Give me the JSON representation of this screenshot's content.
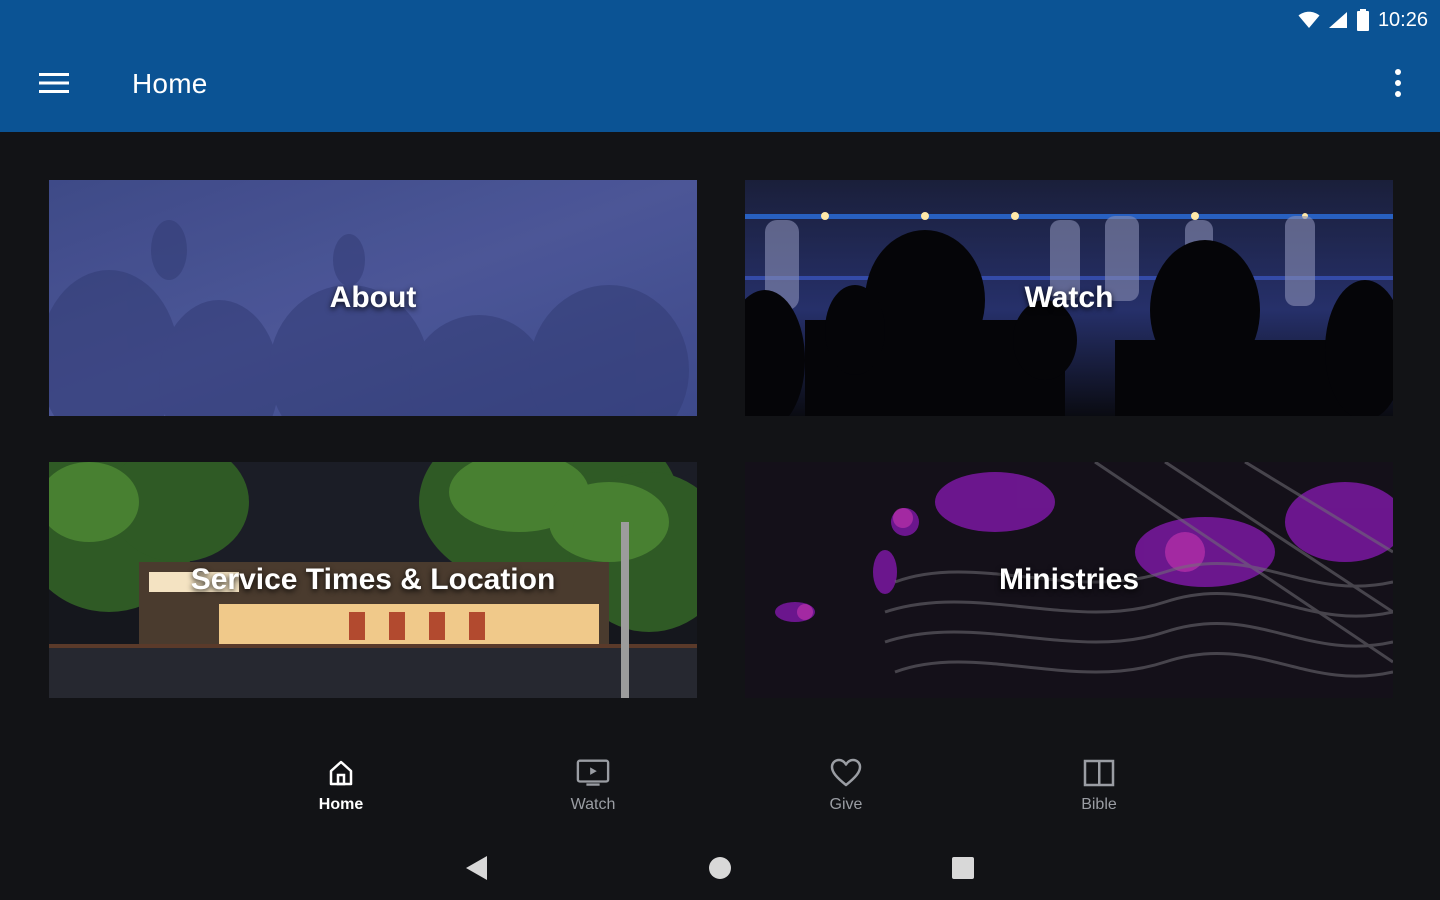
{
  "status_bar": {
    "time": "10:26",
    "icons": [
      "wifi-icon",
      "cell-signal-icon",
      "battery-icon"
    ]
  },
  "app_bar": {
    "title": "Home",
    "menu_icon": "hamburger-menu-icon",
    "overflow_icon": "more-vert-icon",
    "color": "#0b5394"
  },
  "tiles": [
    {
      "label": "About"
    },
    {
      "label": "Watch"
    },
    {
      "label": "Service Times & Location"
    },
    {
      "label": "Ministries"
    }
  ],
  "bottom_nav": {
    "items": [
      {
        "label": "Home",
        "icon": "home-icon",
        "active": true
      },
      {
        "label": "Watch",
        "icon": "tv-icon",
        "active": false
      },
      {
        "label": "Give",
        "icon": "heart-icon",
        "active": false
      },
      {
        "label": "Bible",
        "icon": "book-icon",
        "active": false
      }
    ]
  },
  "system_nav": {
    "icons": [
      "back-icon",
      "home-circle-icon",
      "recents-icon"
    ]
  },
  "colors": {
    "background": "#121316",
    "app_bar": "#0b5394",
    "nav_inactive": "#9a9da3",
    "nav_active": "#ffffff"
  }
}
